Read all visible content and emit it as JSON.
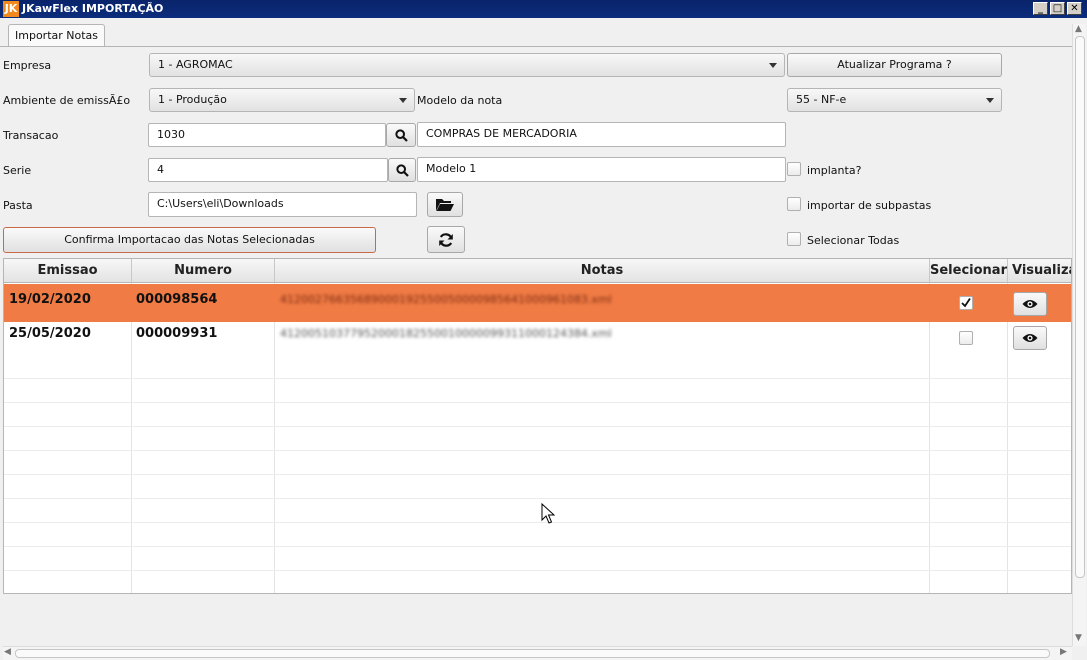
{
  "window": {
    "title": "JKawFlex IMPORTAÇÃO",
    "icon_glyph": "JK",
    "icon_color": "#f08a1e",
    "controls": [
      "minimize-icon",
      "maximize-icon",
      "close-icon"
    ]
  },
  "tab": {
    "label": "Importar Notas"
  },
  "form": {
    "empresa_label": "Empresa",
    "empresa_value": "1 - AGROMAC",
    "atualizar_button": "Atualizar Programa ?",
    "ambiente_label": "Ambiente de emissÃ£o",
    "ambiente_value": "1 - Produção",
    "modelo_label": "Modelo da nota",
    "modelo_value": "55 - NF-e",
    "transacao_label": "Transacao",
    "transacao_value": "1030",
    "transacao_desc": "COMPRAS DE MERCADORIA",
    "serie_label": "Serie",
    "serie_value": "4",
    "serie_desc": "Modelo 1",
    "implanta_label": "implanta?",
    "pasta_label": "Pasta",
    "pasta_value": "C:\\Users\\eli\\Downloads",
    "subpastas_label": "importar de subpastas",
    "confirma_button": "Confirma Importacao das Notas Selecionadas",
    "selecionar_todas_label": "Selecionar Todas"
  },
  "table": {
    "columns": [
      "Emissao",
      "Numero",
      "Notas",
      "Selecionar",
      "Visualiza"
    ],
    "rows": [
      {
        "emissao": "19/02/2020",
        "numero": "000098564",
        "notas": "41200276635689000192550050000985641000961083.xml",
        "selected": true
      },
      {
        "emissao": "25/05/2020",
        "numero": "000009931",
        "notas": "41200510377952000182550010000099311000124384.xml",
        "selected": false
      }
    ],
    "selected_row_color": "#f07b45"
  }
}
